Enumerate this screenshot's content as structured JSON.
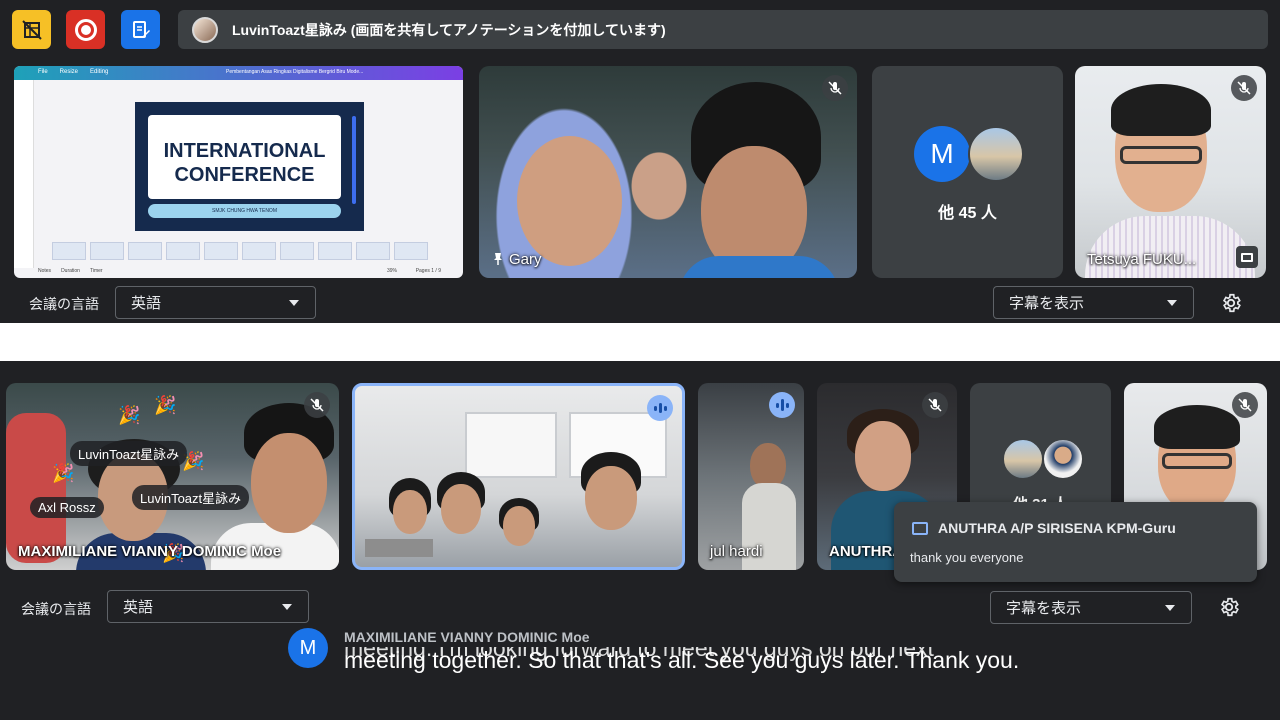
{
  "top": {
    "topbar": {
      "share_banner_text": "LuvinToazt星詠み (画面を共有してアノテーションを付加しています)"
    },
    "presentation": {
      "menu": [
        "File",
        "Resize",
        "Editing"
      ],
      "doc_title": "Pembentangan Asas Ringkas Digitalisme Bergrid Biru Mode...",
      "slide_title_line1": "INTERNATIONAL",
      "slide_title_line2": "CONFERENCE",
      "slide_search_text": "SMJK CHUNG HWA TENOM",
      "footer_notes": "Notes",
      "footer_duration": "Duration",
      "footer_timer": "Timer",
      "zoom": "39%",
      "pages_label": "Pages",
      "pages_count": "1 / 9"
    },
    "tiles": {
      "gary_name": "Gary",
      "others_avatar_letter": "M",
      "others_count": "他 45 人",
      "tetsuya_name": "Tetsuya FUKU..."
    },
    "language_label": "会議の言語",
    "language_value": "英語",
    "captions_select": "字幕を表示"
  },
  "bottom": {
    "tiles": {
      "maxi_name": "MAXIMILIANE VIANNY DOMINIC Moe",
      "reaction_chip_1": "LuvinToazt星詠み",
      "reaction_chip_2": "LuvinToazt星詠み",
      "reaction_chip_3": "Axl Rossz",
      "jul_name": "jul hardi",
      "anuthra_name": "ANUTHRA",
      "others_partial": "他 31 人"
    },
    "chat_popup": {
      "sender": "ANUTHRA A/P SIRISENA KPM-Guru",
      "message": "thank you everyone"
    },
    "language_label": "会議の言語",
    "language_value": "英語",
    "captions_select": "字幕を表示",
    "caption": {
      "avatar_letter": "M",
      "speaker": "MAXIMILIANE VIANNY DOMINIC Moe",
      "partial_line": "meeting. I'm looking forward to meet you guys on our next",
      "text": "meeting together. So that that's all. See you guys later. Thank you."
    }
  }
}
